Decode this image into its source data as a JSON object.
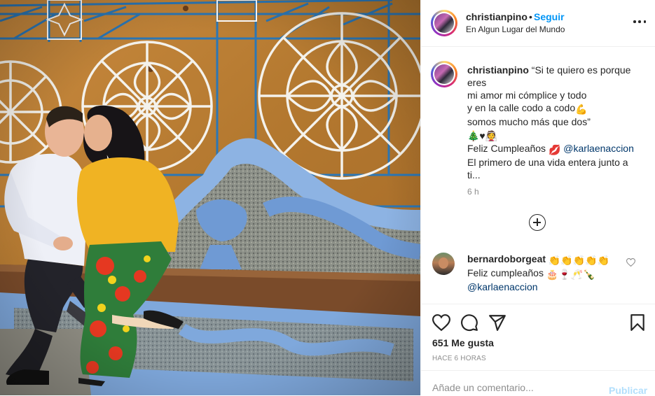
{
  "header": {
    "username": "christianpino",
    "separator": "•",
    "follow_label": "Seguir",
    "location": "En Algun Lugar del Mundo"
  },
  "caption": {
    "username": "christianpino",
    "lines": [
      "“Si te quiero es porque",
      "eres",
      "mi amor mi cómplice y todo",
      "y en la calle codo a codo",
      "somos mucho más que dos”"
    ],
    "emoji_line": "🎄♥👰",
    "flex_emoji": "💪",
    "birthday_text": "Feliz Cumpleaños",
    "kiss_emoji": "💋",
    "mention": "@karlaenaccion",
    "closing_lines": [
      "El primero de una vida entera junto a",
      "ti..."
    ],
    "time": "6 h"
  },
  "comment": {
    "username": "bernardoborgeat",
    "claps": "👏👏👏👏👏",
    "text": "Feliz cumpleaños",
    "emojis": "🎂🍷🥂🍾",
    "mention": "@karlaenaccion"
  },
  "actions": {
    "icons": [
      "heart-icon",
      "comment-icon",
      "share-icon",
      "bookmark-icon"
    ]
  },
  "likes": "651 Me gusta",
  "posted": "HACE 6 HORAS",
  "add_comment": {
    "placeholder": "Añade un comentario...",
    "publish_label": "Publicar"
  },
  "colors": {
    "link_blue": "#0095f6",
    "mention_blue": "#00376b",
    "muted": "#8e8e8e",
    "publish_disabled": "#b2dffc"
  }
}
